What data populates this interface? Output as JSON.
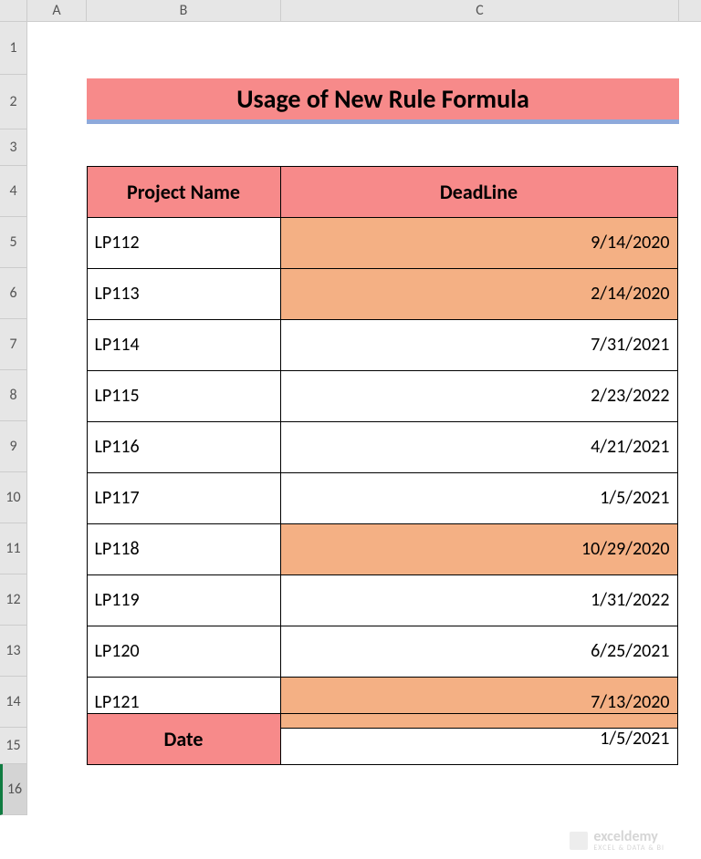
{
  "columns": [
    "A",
    "B",
    "C"
  ],
  "rows": [
    "1",
    "2",
    "3",
    "4",
    "5",
    "6",
    "7",
    "8",
    "9",
    "10",
    "11",
    "12",
    "13",
    "14",
    "15",
    "16"
  ],
  "title": "Usage of New Rule Formula",
  "headers": {
    "project_name": "Project Name",
    "deadline": "DeadLine"
  },
  "projects": [
    {
      "name": "LP112",
      "deadline": "9/14/2020",
      "highlight": true
    },
    {
      "name": "LP113",
      "deadline": "2/14/2020",
      "highlight": true
    },
    {
      "name": "LP114",
      "deadline": "7/31/2021",
      "highlight": false
    },
    {
      "name": "LP115",
      "deadline": "2/23/2022",
      "highlight": false
    },
    {
      "name": "LP116",
      "deadline": "4/21/2021",
      "highlight": false
    },
    {
      "name": "LP117",
      "deadline": "1/5/2021",
      "highlight": false
    },
    {
      "name": "LP118",
      "deadline": "10/29/2020",
      "highlight": true
    },
    {
      "name": "LP119",
      "deadline": "1/31/2022",
      "highlight": false
    },
    {
      "name": "LP120",
      "deadline": "6/25/2021",
      "highlight": false
    },
    {
      "name": "LP121",
      "deadline": "7/13/2020",
      "highlight": true
    }
  ],
  "date_label": "Date",
  "date_value": "1/5/2021",
  "watermark": {
    "brand": "exceldemy",
    "tagline": "EXCEL & DATA & BI"
  }
}
